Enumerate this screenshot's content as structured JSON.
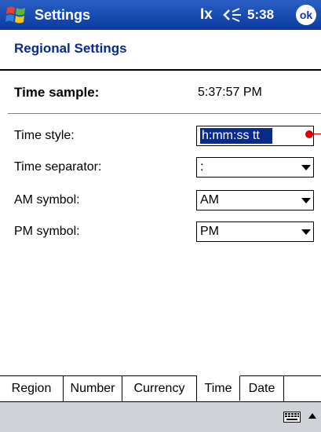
{
  "titlebar": {
    "title": "Settings",
    "connectivity_glyph": "Ix",
    "clock": "5:38",
    "ok_label": "ok",
    "icons": [
      "windows-start-icon",
      "connectivity-icon",
      "volume-icon"
    ]
  },
  "page": {
    "title": "Regional Settings"
  },
  "sample": {
    "label": "Time sample:",
    "value": "5:37:57 PM"
  },
  "settings": {
    "time_style": {
      "label": "Time style:",
      "value": "h:mm:ss tt"
    },
    "time_separator": {
      "label": "Time separator:",
      "value": ":"
    },
    "am_symbol": {
      "label": "AM symbol:",
      "value": "AM"
    },
    "pm_symbol": {
      "label": "PM symbol:",
      "value": "PM"
    }
  },
  "tabs": [
    {
      "label": "Region"
    },
    {
      "label": "Number"
    },
    {
      "label": "Currency"
    },
    {
      "label": "Time",
      "selected": true
    },
    {
      "label": "Date"
    }
  ],
  "cmdbar": {
    "icons": [
      "keyboard-icon",
      "sip-arrow-up-icon"
    ]
  },
  "colors": {
    "titlebar": "#0b3aa0",
    "header_text": "#0a2a8c",
    "selection": "#0a2a8c",
    "annotation": "#e00000",
    "cmdbar": "#cfd3d7"
  }
}
